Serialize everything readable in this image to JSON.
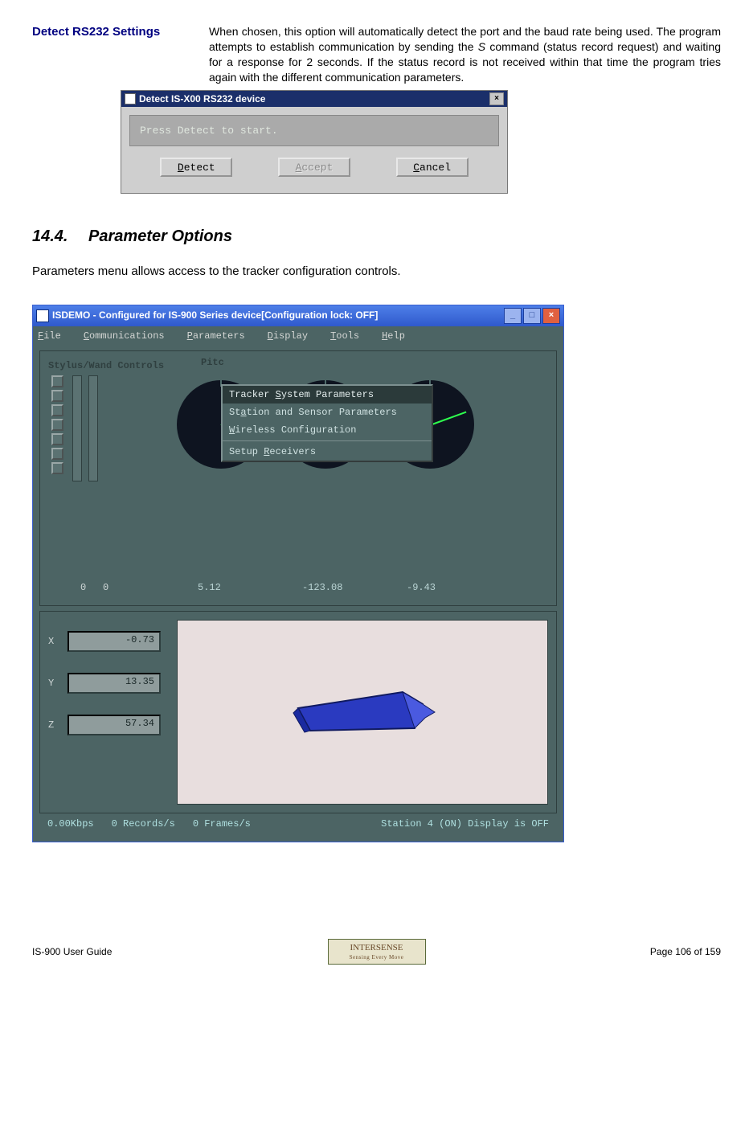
{
  "intro": {
    "label": "Detect RS232 Settings",
    "text_a": "When chosen, this option will automatically detect the port and the baud rate being used.  The program attempts to establish communication by sending the ",
    "text_s": "S",
    "text_b": " command (status record request) and waiting for a response for 2 seconds.  If the status record is not received within that time the program tries again with the different communication parameters."
  },
  "dlg1": {
    "title": "Detect IS-X00 RS232 device",
    "msg": "Press Detect to start.",
    "detect_u": "D",
    "detect_rest": "etect",
    "accept_u": "A",
    "accept_rest": "ccept",
    "cancel_u": "C",
    "cancel_rest": "ancel"
  },
  "heading": {
    "num": "14.4.",
    "title": "Parameter Options"
  },
  "para": "Parameters menu allows access to the tracker configuration controls.",
  "app": {
    "title": "ISDEMO - Configured for IS-900 Series device[Configuration lock: OFF]",
    "menu": {
      "file_u": "F",
      "file_r": "ile",
      "comm_u": "C",
      "comm_r": "ommunications",
      "param_u": "P",
      "param_r": "arameters",
      "disp_u": "D",
      "disp_r": "isplay",
      "tools_u": "T",
      "tools_r": "ools",
      "help_u": "H",
      "help_r": "elp"
    },
    "stylus_label": "Stylus/Wand Controls",
    "pitch_label": "Pitc",
    "dropdown": {
      "i1a": "Tracker ",
      "i1u": "S",
      "i1b": "ystem Parameters",
      "i2a": "St",
      "i2u": "a",
      "i2b": "tion and Sensor Parameters",
      "i3a": "",
      "i3u": "W",
      "i3b": "ireless Configuration",
      "i4a": "Setup ",
      "i4u": "R",
      "i4b": "eceivers"
    },
    "zeros": {
      "a": "0",
      "b": "0"
    },
    "dialvals": {
      "v1": "5.12",
      "v2": "-123.08",
      "v3": "-9.43"
    },
    "xyz": {
      "xl": "X",
      "xv": "-0.73",
      "yl": "Y",
      "yv": "13.35",
      "zl": "Z",
      "zv": "57.34"
    },
    "status": {
      "kbps": "0.00Kbps",
      "recs": "0 Records/s",
      "frames": "0 Frames/s",
      "right": "Station 4 (ON) Display is OFF"
    }
  },
  "footer": {
    "left": "IS-900 User Guide",
    "right": "Page 106 of 159",
    "logo_main": "INTERSENSE",
    "logo_sub": "Sensing Every Move"
  },
  "chart_data": {
    "type": "table",
    "orientation_deg": {
      "pitch_like": 5.12,
      "value2": -123.08,
      "value3": -9.43
    },
    "position": {
      "X": -0.73,
      "Y": 13.35,
      "Z": 57.34
    },
    "stylus_wand_bars": [
      0,
      0
    ],
    "status": {
      "kbps": 0.0,
      "records_per_s": 0,
      "frames_per_s": 0,
      "station": 4,
      "station_on": true,
      "display_on": false
    }
  }
}
